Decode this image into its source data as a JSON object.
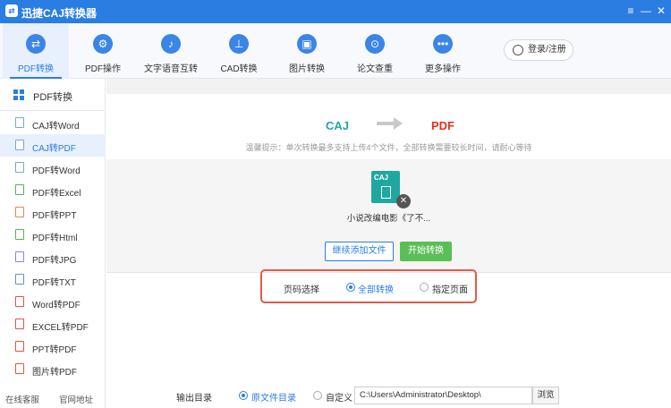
{
  "app": {
    "title": "迅捷CAJ转换器",
    "accent": "#2a7de1"
  },
  "window_controls": {
    "menu": "≡",
    "minimize": "—",
    "close": "✕"
  },
  "toolbar": {
    "items": [
      {
        "label": "PDF转换",
        "icon": "⇄",
        "active": true
      },
      {
        "label": "PDF操作",
        "icon": "⚙"
      },
      {
        "label": "文字语音互转",
        "icon": "♪"
      },
      {
        "label": "CAD转换",
        "icon": "⊥"
      },
      {
        "label": "图片转换",
        "icon": "▣"
      },
      {
        "label": "论文查重",
        "icon": "⊙"
      },
      {
        "label": "更多操作",
        "icon": "•••"
      }
    ],
    "login_label": "登录/注册"
  },
  "sidebar": {
    "header": "PDF转换",
    "items": [
      {
        "label": "CAJ转Word"
      },
      {
        "label": "CAJ转PDF",
        "active": true
      },
      {
        "label": "PDF转Word"
      },
      {
        "label": "PDF转Excel"
      },
      {
        "label": "PDF转PPT"
      },
      {
        "label": "PDF转Html"
      },
      {
        "label": "PDF转JPG"
      },
      {
        "label": "PDF转TXT"
      },
      {
        "label": "Word转PDF"
      },
      {
        "label": "EXCEL转PDF"
      },
      {
        "label": "PPT转PDF"
      },
      {
        "label": "图片转PDF"
      }
    ],
    "footer": {
      "service": "在线客服",
      "website": "官网地址"
    }
  },
  "main": {
    "from_format": "CAJ",
    "to_format": "PDF",
    "tip": "温馨提示：单次转换最多支持上传4个文件，全部转换需要较长时间，请耐心等待",
    "file": {
      "badge": "CAJ",
      "name": "小说改编电影《了不..."
    },
    "add_button": "继续添加文件",
    "start_button": "开始转换",
    "page_select": {
      "label": "页码选择",
      "options": [
        "全部转换",
        "指定页面"
      ],
      "selected": "全部转换"
    },
    "output": {
      "label": "输出目录",
      "options": [
        "原文件目录",
        "自定义"
      ],
      "selected": "原文件目录",
      "path": "C:\\Users\\Administrator\\Desktop\\",
      "browse": "浏览"
    }
  }
}
